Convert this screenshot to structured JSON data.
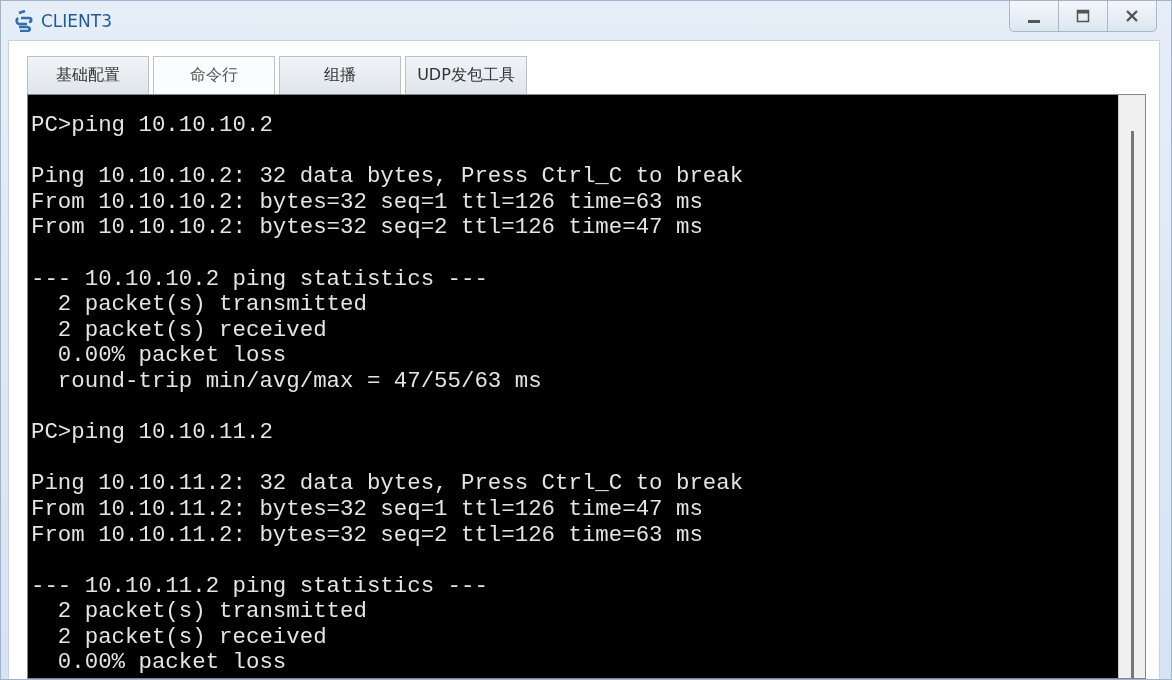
{
  "window": {
    "title": "CLIENT3"
  },
  "tabs": [
    {
      "label": "基础配置",
      "selected": false
    },
    {
      "label": "命令行",
      "selected": true
    },
    {
      "label": "组播",
      "selected": false
    },
    {
      "label": "UDP发包工具",
      "selected": false
    }
  ],
  "terminal": {
    "blocks": [
      [
        "PC>ping 10.10.10.2"
      ],
      [
        "Ping 10.10.10.2: 32 data bytes, Press Ctrl_C to break",
        "From 10.10.10.2: bytes=32 seq=1 ttl=126 time=63 ms",
        "From 10.10.10.2: bytes=32 seq=2 ttl=126 time=47 ms"
      ],
      [
        "--- 10.10.10.2 ping statistics ---",
        "  2 packet(s) transmitted",
        "  2 packet(s) received",
        "  0.00% packet loss",
        "  round-trip min/avg/max = 47/55/63 ms"
      ],
      [
        "PC>ping 10.10.11.2"
      ],
      [
        "Ping 10.10.11.2: 32 data bytes, Press Ctrl_C to break",
        "From 10.10.11.2: bytes=32 seq=1 ttl=126 time=47 ms",
        "From 10.10.11.2: bytes=32 seq=2 ttl=126 time=63 ms"
      ],
      [
        "--- 10.10.11.2 ping statistics ---",
        "  2 packet(s) transmitted",
        "  2 packet(s) received",
        "  0.00% packet loss"
      ]
    ]
  }
}
